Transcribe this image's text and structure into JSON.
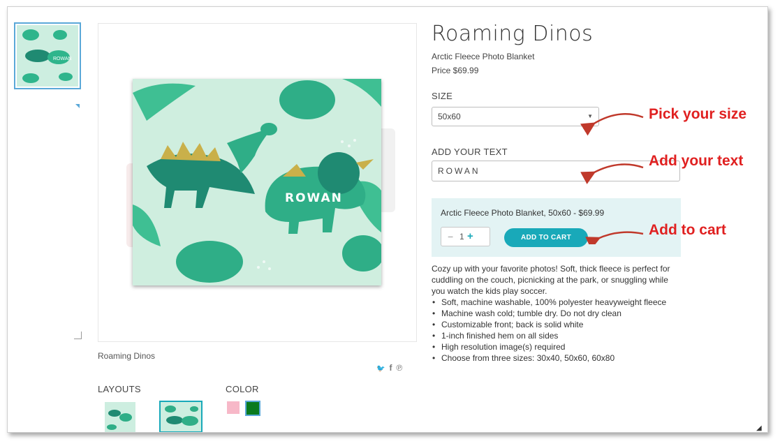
{
  "product": {
    "title": "Roaming Dinos",
    "subtitle": "Arctic Fleece Photo Blanket",
    "price": "Price $69.99",
    "caption": "Roaming Dinos"
  },
  "options": {
    "size_label": "SIZE",
    "size_value": "50x60",
    "text_label": "ADD YOUR TEXT",
    "text_value": "ROWAN",
    "layouts_label": "LAYOUTS",
    "color_label": "COLOR"
  },
  "cart": {
    "summary": "Arctic Fleece Photo Blanket, 50x60 - $69.99",
    "qty_minus": "−",
    "qty_value": "1",
    "qty_plus": "+",
    "button": "ADD TO CART"
  },
  "description": {
    "intro": "Cozy up with your favorite photos! Soft, thick fleece is perfect for cuddling on the couch, picnicking at the park, or snuggling while you watch the kids play soccer.",
    "bullets": [
      "Soft, machine washable, 100% polyester heavyweight fleece",
      "Machine wash cold; tumble dry. Do not dry clean",
      "Customizable front; back is solid white",
      "1-inch finished hem on all sides",
      "High resolution image(s) required",
      "Choose from three sizes: 30x40, 50x60, 60x80"
    ]
  },
  "blanket_text": "ROWAN",
  "annotations": {
    "size": "Pick your size",
    "text": "Add your text",
    "cart": "Add to cart"
  },
  "social": {
    "twitter": "🐦",
    "facebook": "f",
    "pinterest": "℗"
  },
  "colors": {
    "accent": "#19a9b9",
    "panel": "#e3f3f4",
    "annotation": "#e02020",
    "swatch_pink": "#f7b8c8",
    "swatch_green": "#0a7a1e",
    "blanket_bg": "#cfeedf"
  }
}
